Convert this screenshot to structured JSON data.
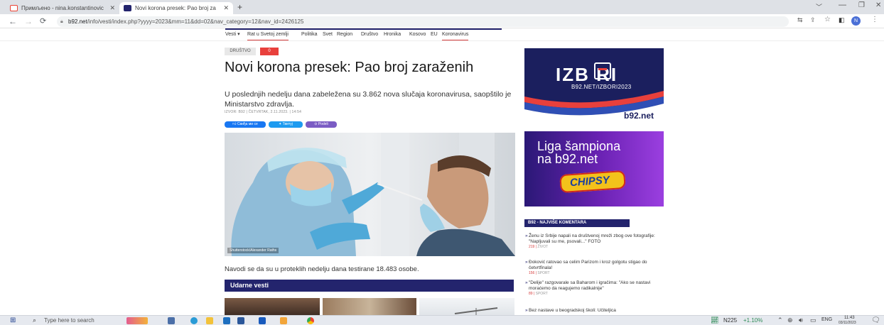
{
  "browser": {
    "tabs": [
      {
        "title": "Примљено - nina.konstantinovic",
        "favicon_color": "#ea4335"
      },
      {
        "title": "Novi korona presek: Pao broj za",
        "favicon_color": "#23246d"
      }
    ],
    "new_tab_symbol": "+",
    "url_host": "b92.net",
    "url_path": "/info/vesti/index.php?yyyy=2023&mm=11&dd=02&nav_category=12&nav_id=2426125",
    "profile_initial": "N"
  },
  "site_nav": {
    "items": [
      "Vesti ▾",
      "Rat u Svetoj zemlji",
      "Politika",
      "Svet",
      "Region",
      "Društvo",
      "Hronika",
      "Kosovo",
      "EU",
      "Koronavirus"
    ]
  },
  "article": {
    "category": "DRUŠTVO",
    "comment_count": "0",
    "title": "Novi korona presek: Pao broj zaraženih",
    "lead": "U poslednjih nedelju dana zabeležena su 3.862 nova slučaja koronavirusa, saopštilo je Ministarstvo zdravlja.",
    "meta": "IZVOR: B92 | ČETVRTAK, 2.11.2023. | 14:54",
    "share_buttons": [
      "Свиђа ми се",
      "Твитуј",
      "Podeli"
    ],
    "photo_caption": "Shutterstock/Alexander Raths",
    "body": "Navodi se da su u proteklih nedelju dana testirane 18.483 osobe.",
    "section_title": "Udarne vesti"
  },
  "sidebar": {
    "ad1": {
      "title": "IZB  RI",
      "subtitle": "B92.NET/IZBORI2023",
      "brand": "b92.net"
    },
    "ad2": {
      "line1": "Liga šampiona",
      "line2": "na b92.net",
      "sponsor": "CHIPSY"
    },
    "comments_header": "B92 - NAJVIŠE KOMENTARA",
    "comments": [
      {
        "text": "Ženu iz Srbije napali na društvenoj mreži zbog ove fotografije: \"Napljuvali su me, psovali...\" FOTO",
        "count": "219",
        "section": "ŽIVOT"
      },
      {
        "text": "Đoković ratovao sa celim Parizom i kroz golgotu stigao do četvrtfinala!",
        "count": "156",
        "section": "SPORT"
      },
      {
        "text": "\"Delije\" razgovarale sa Baharom i igračima: \"Ako se nastavi moraćemo da reagujemo radikalnije\"",
        "count": "89",
        "section": "SPORT"
      },
      {
        "text": "Bez nastave u beogradskoj školi: Učiteljica",
        "count": "",
        "section": ""
      }
    ]
  },
  "taskbar": {
    "search_placeholder": "Type here to search",
    "ticker": "N225",
    "ticker_change": "+1.10%",
    "language": "ENG",
    "time": "11:43",
    "date": "03/11/2023"
  }
}
